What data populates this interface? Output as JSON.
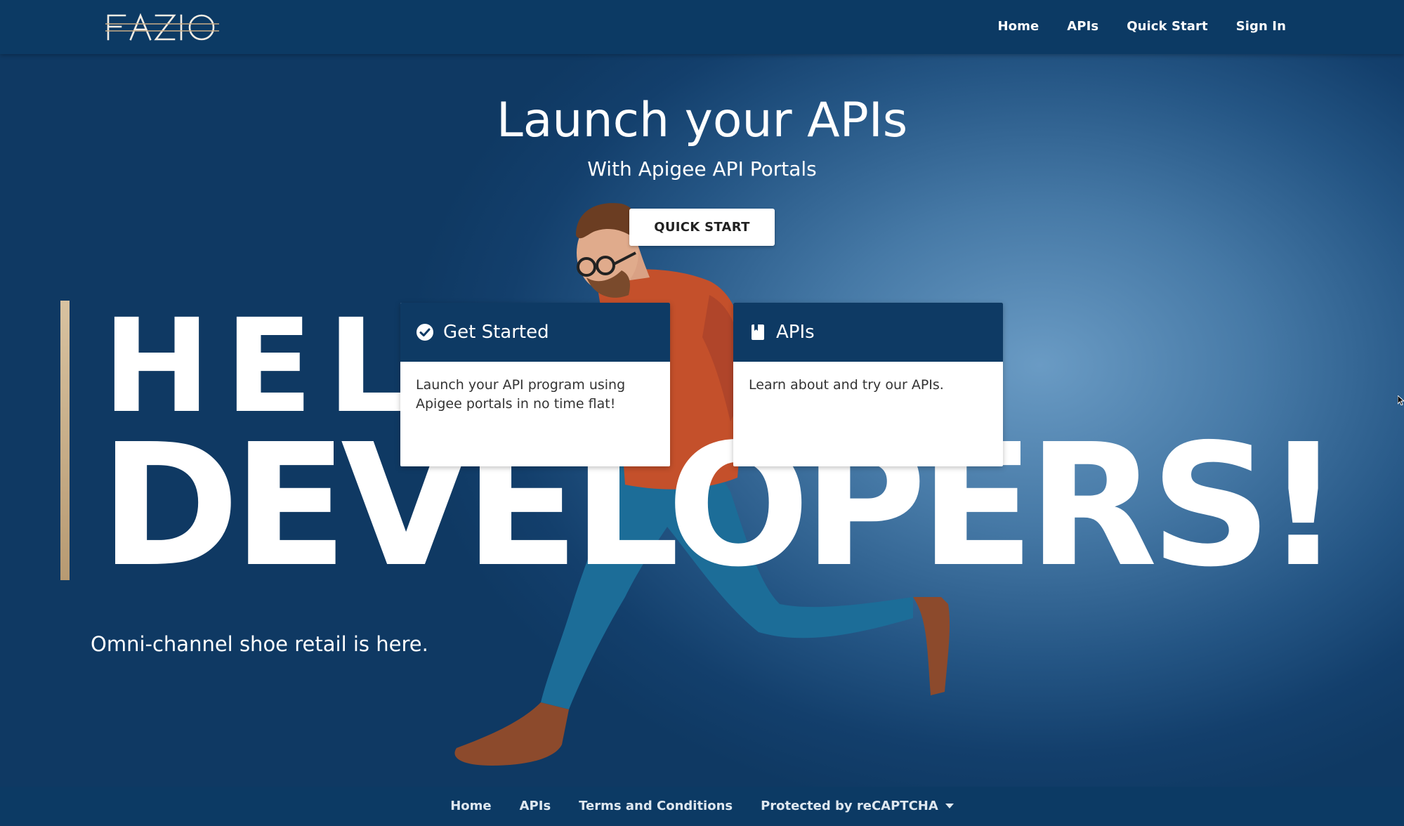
{
  "brand": {
    "logo_text": "FAZIO"
  },
  "nav": {
    "items": [
      {
        "label": "Home"
      },
      {
        "label": "APIs"
      },
      {
        "label": "Quick Start"
      },
      {
        "label": "Sign In"
      }
    ]
  },
  "hero": {
    "title": "Launch your APIs",
    "subtitle": "With Apigee API Portals",
    "cta_label": "QUICK START",
    "hello_text": "HELLO",
    "developers_text": "DEVELOPERS!",
    "tagline": "Omni-channel shoe retail is here."
  },
  "cards": [
    {
      "icon": "check-circle-icon",
      "title": "Get Started",
      "body": "Launch your API program using Apigee portals in no time flat!"
    },
    {
      "icon": "book-icon",
      "title": "APIs",
      "body": "Learn about and try our APIs."
    }
  ],
  "footer": {
    "links": [
      {
        "label": "Home"
      },
      {
        "label": "APIs"
      },
      {
        "label": "Terms and Conditions"
      }
    ],
    "recaptcha_label": "Protected by reCAPTCHA"
  },
  "colors": {
    "header_bg": "#0c3a64",
    "card_header_bg": "#0e3a64",
    "accent_bar": "#c9ad85",
    "hero_bg": "#245584"
  }
}
